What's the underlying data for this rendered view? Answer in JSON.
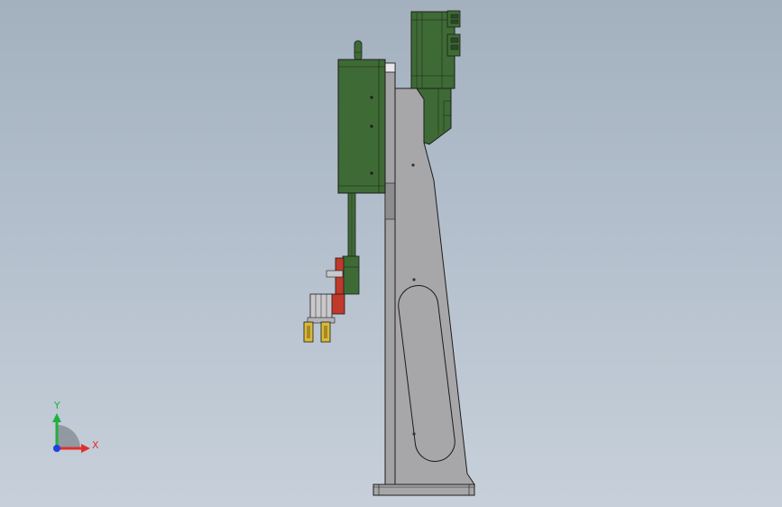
{
  "viewport": {
    "background_top": "#a3b0be",
    "background_bottom": "#c7d0da"
  },
  "colors": {
    "motor_green": "#3e6b35",
    "motor_green_dark": "#2a4a24",
    "frame_gray": "#a7a7aa",
    "outline": "#1c1c1c",
    "gripper_red": "#c0392b",
    "finger_yellow": "#d8b93a",
    "axis_x": "#e03030",
    "axis_y": "#20b040",
    "axis_z": "#2040e0"
  },
  "triad": {
    "x_label": "X",
    "y_label": "Y"
  }
}
